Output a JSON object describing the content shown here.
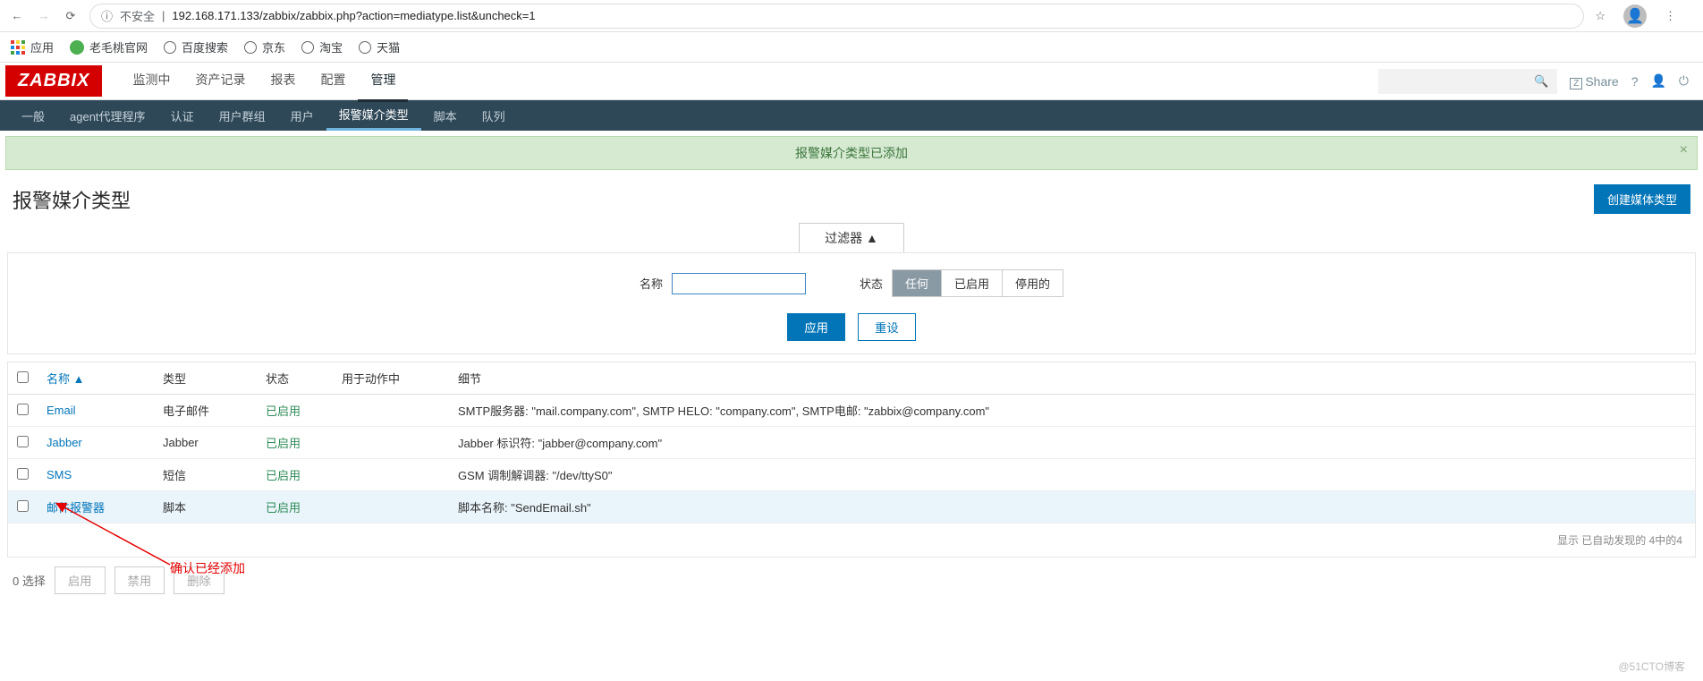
{
  "browser": {
    "insecure": "不安全",
    "url": "192.168.171.133/zabbix/zabbix.php?action=mediatype.list&uncheck=1"
  },
  "bookmarks": {
    "apps": "应用",
    "items": [
      "老毛桃官网",
      "百度搜索",
      "京东",
      "淘宝",
      "天猫"
    ]
  },
  "header": {
    "logo": "ZABBIX",
    "nav": [
      "监测中",
      "资产记录",
      "报表",
      "配置",
      "管理"
    ],
    "active_nav": 4,
    "share": "Share",
    "help": "?"
  },
  "subnav": {
    "items": [
      "一般",
      "agent代理程序",
      "认证",
      "用户群组",
      "用户",
      "报警媒介类型",
      "脚本",
      "队列"
    ],
    "active": 5
  },
  "message": "报警媒介类型已添加",
  "page": {
    "title": "报警媒介类型",
    "create_btn": "创建媒体类型"
  },
  "filter": {
    "tab": "过滤器 ▲",
    "name_label": "名称",
    "name_value": "",
    "status_label": "状态",
    "status_opts": [
      "任何",
      "已启用",
      "停用的"
    ],
    "apply": "应用",
    "reset": "重设"
  },
  "table": {
    "headers": {
      "name": "名称 ▲",
      "type": "类型",
      "status": "状态",
      "used_in": "用于动作中",
      "details": "细节"
    },
    "rows": [
      {
        "name": "Email",
        "type": "电子邮件",
        "status": "已启用",
        "used": "",
        "details": "SMTP服务器: \"mail.company.com\", SMTP HELO: \"company.com\", SMTP电邮: \"zabbix@company.com\""
      },
      {
        "name": "Jabber",
        "type": "Jabber",
        "status": "已启用",
        "used": "",
        "details": "Jabber 标识符: \"jabber@company.com\""
      },
      {
        "name": "SMS",
        "type": "短信",
        "status": "已启用",
        "used": "",
        "details": "GSM 调制解调器: \"/dev/ttyS0\""
      },
      {
        "name": "邮件报警器",
        "type": "脚本",
        "status": "已启用",
        "used": "",
        "details": "脚本名称: \"SendEmail.sh\"",
        "highlight": true
      }
    ],
    "footer": "显示 已自动发现的 4中的4"
  },
  "bottom": {
    "selected": "0 选择",
    "enable": "启用",
    "disable": "禁用",
    "delete": "删除"
  },
  "annotation": "确认已经添加",
  "watermark": "@51CTO博客"
}
